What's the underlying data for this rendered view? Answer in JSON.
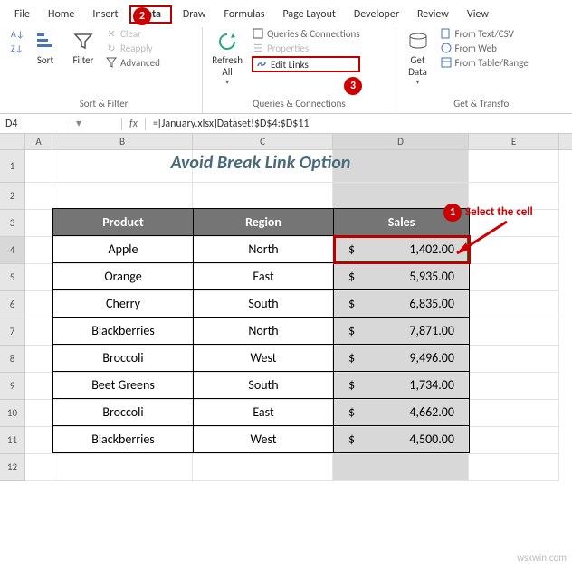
{
  "menu": {
    "file": "File",
    "home": "Home",
    "insert": "Insert",
    "data": "Data",
    "draw": "Draw",
    "formulas": "Formulas",
    "page_layout": "Page Layout",
    "developer": "Developer",
    "review": "Review",
    "view": "View"
  },
  "ribbon": {
    "sort": "Sort",
    "filter": "Filter",
    "clear": "Clear",
    "reapply": "Reapply",
    "advanced": "Advanced",
    "sort_filter_label": "Sort & Filter",
    "refresh_all": "Refresh\nAll",
    "queries_conn": "Queries & Connections",
    "properties": "Properties",
    "edit_links": "Edit Links",
    "queries_label": "Queries & Connections",
    "get_data": "Get\nData",
    "from_text": "From Text/CSV",
    "from_web": "From Web",
    "from_table": "From Table/Range",
    "get_transform_label": "Get & Transfo"
  },
  "namebox": "D4",
  "formula": "=[January.xlsx]Dataset!$D$4:$D$11",
  "cols": {
    "A": "A",
    "B": "B",
    "C": "C",
    "D": "D",
    "E": "E"
  },
  "rows": [
    "1",
    "2",
    "3",
    "4",
    "5",
    "6",
    "7",
    "8",
    "9",
    "10",
    "11",
    "12"
  ],
  "sheet_title": "Avoid Break Link Option",
  "headers": {
    "product": "Product",
    "region": "Region",
    "sales": "Sales"
  },
  "data": [
    {
      "p": "Apple",
      "r": "North",
      "s": "1,402.00"
    },
    {
      "p": "Orange",
      "r": "East",
      "s": "5,935.00"
    },
    {
      "p": "Cherry",
      "r": "South",
      "s": "6,835.00"
    },
    {
      "p": "Blackberries",
      "r": "North",
      "s": "7,871.00"
    },
    {
      "p": "Broccoli",
      "r": "West",
      "s": "9,496.00"
    },
    {
      "p": "Beet Greens",
      "r": "South",
      "s": "1,734.00"
    },
    {
      "p": "Broccoli",
      "r": "East",
      "s": "4,662.00"
    },
    {
      "p": "Blackberries",
      "r": "West",
      "s": "4,500.00"
    }
  ],
  "currency": "$",
  "callouts": {
    "c1": "1",
    "c2": "2",
    "c3": "3",
    "select": "Select the cell"
  },
  "watermark": "wsxwin.com",
  "chart_data": {
    "type": "table",
    "title": "Avoid Break Link Option",
    "columns": [
      "Product",
      "Region",
      "Sales"
    ],
    "rows": [
      [
        "Apple",
        "North",
        1402.0
      ],
      [
        "Orange",
        "East",
        5935.0
      ],
      [
        "Cherry",
        "South",
        6835.0
      ],
      [
        "Blackberries",
        "North",
        7871.0
      ],
      [
        "Broccoli",
        "West",
        9496.0
      ],
      [
        "Beet Greens",
        "South",
        1734.0
      ],
      [
        "Broccoli",
        "East",
        4662.0
      ],
      [
        "Blackberries",
        "West",
        4500.0
      ]
    ]
  }
}
